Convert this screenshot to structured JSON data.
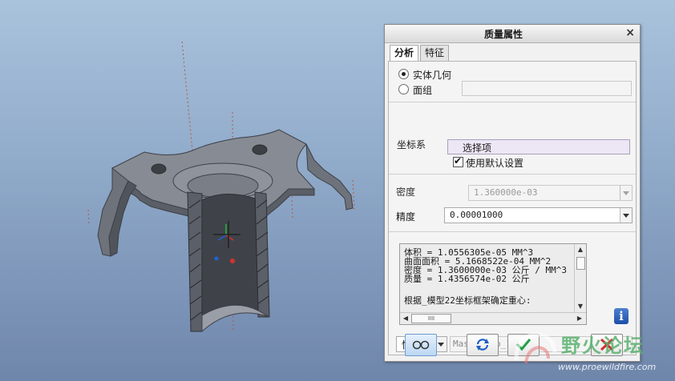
{
  "dialog": {
    "title": "质量属性",
    "close_glyph": "×",
    "tabs": [
      {
        "label": "分析",
        "active": true
      },
      {
        "label": "特征",
        "active": false
      }
    ],
    "geometry_type": {
      "options": [
        {
          "label": "实体几何",
          "selected": true
        },
        {
          "label": "面组",
          "selected": false
        }
      ],
      "quilt_field_value": ""
    },
    "coordinate_system": {
      "label": "坐标系",
      "select_value": "选择项",
      "use_default_label": "使用默认设置",
      "use_default_checked": true
    },
    "density": {
      "label": "密度",
      "value": "1.360000e-03",
      "disabled": true
    },
    "precision": {
      "label": "精度",
      "value": "0.00001000"
    },
    "results": {
      "lines": [
        "体积 =  1.0556305e-05  MM^3",
        "曲面面积 =  5.1668522e-04  MM^2",
        "密度 =  1.3600000e-03 公斤 / MM^3",
        "质量 =  1.4356574e-02 公斤"
      ],
      "note": "根据_模型22坐标框架确定重心:",
      "hthumb_glyph": "IIII"
    },
    "info_icon": "i",
    "mode": {
      "value": "快速"
    },
    "feature_name": "Mass_Prop_1",
    "buttons": [
      "view-glasses",
      "recompute",
      "ok",
      "cancel"
    ]
  },
  "watermark": {
    "title": "野火论坛",
    "url": "www.proewildfire.com"
  },
  "colors": {
    "viewport_top": "#a9c3dd",
    "viewport_bottom": "#6f86ab",
    "part_fill": "#7b7f87",
    "part_dark": "#45494f",
    "ok_green": "#22a04a",
    "cancel_red": "#d03030"
  }
}
